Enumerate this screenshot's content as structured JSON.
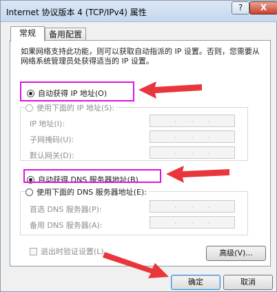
{
  "window": {
    "title": "Internet 协议版本 4 (TCP/IPv4) 属性",
    "help_label": "?",
    "close_label": "X"
  },
  "tabs": [
    {
      "label": "常规",
      "active": true
    },
    {
      "label": "备用配置",
      "active": false
    }
  ],
  "intro_text": "如果网络支持此功能，则可以获取自动指派的 IP 设置。否则，您需要从网络系统管理员处获得适当的 IP 设置。",
  "ip_section": {
    "auto_label": "自动获得 IP 地址(O)",
    "auto_checked": true,
    "manual_label": "使用下面的 IP 地址(S):",
    "fields": [
      {
        "label": "IP 地址(I):",
        "value": ". . ."
      },
      {
        "label": "子网掩码(U):",
        "value": ". . ."
      },
      {
        "label": "默认网关(D):",
        "value": ". . ."
      }
    ]
  },
  "dns_section": {
    "auto_label": "自动获得 DNS 服务器地址(B)",
    "auto_checked": true,
    "manual_label": "使用下面的 DNS 服务器地址(E):",
    "fields": [
      {
        "label": "首选 DNS 服务器(P):",
        "value": ". . ."
      },
      {
        "label": "备用 DNS 服务器(A):",
        "value": ". . ."
      }
    ]
  },
  "validate_checkbox_label": "退出时验证设置(L)",
  "advanced_button_label": "高级(V)...",
  "ok_button_label": "确定",
  "cancel_button_label": "取消",
  "colors": {
    "highlight_box": "#e010e0",
    "arrow": "#e8363c",
    "focus_border": "#3a8ad6"
  }
}
